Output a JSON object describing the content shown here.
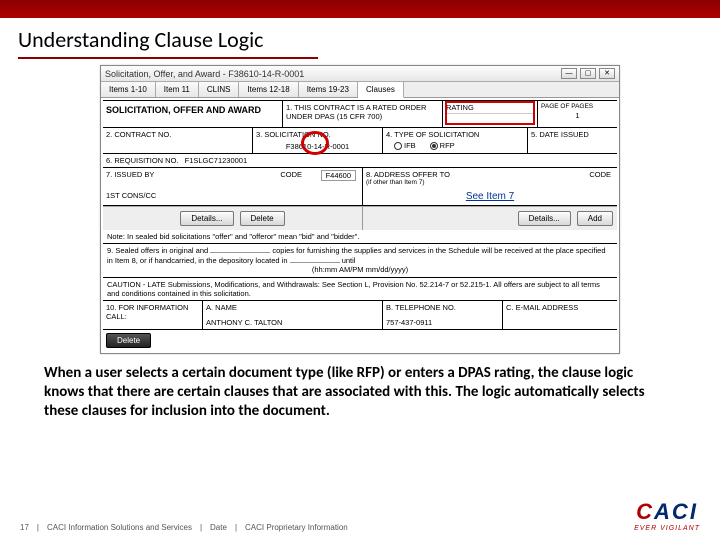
{
  "slide": {
    "title": "Understanding Clause Logic",
    "body": "When a user selects a certain document type (like RFP) or enters a DPAS rating, the clause logic knows that there are certain clauses that are associated with this.  The logic automatically selects these clauses for inclusion into the document."
  },
  "window": {
    "title": "Solicitation, Offer, and Award - F38610-14-R-0001",
    "tabs": [
      "Items 1-10",
      "Item 11",
      "CLINS",
      "Items 12-18",
      "Items 19-23",
      "Clauses"
    ],
    "active_tab": 5
  },
  "form": {
    "header": "SOLICITATION, OFFER AND AWARD",
    "box1": "1. THIS CONTRACT IS A RATED ORDER UNDER DPAS (15 CFR 700)",
    "rating_label": "RATING",
    "page_label": "PAGE   OF   PAGES",
    "page_value": "1",
    "box2": "2. CONTRACT NO.",
    "box3_label": "3. SOLICITATION NO.",
    "box3_value": "F38610-14-R-0001",
    "box4_label": "4. TYPE OF SOLICITATION",
    "box4_ifb": "IFB",
    "box4_rfp": "RFP",
    "box5": "5. DATE ISSUED",
    "box6_label": "6. REQUISITION NO.",
    "box6_value": "F1SLGC71230001",
    "box7_label": "7. ISSUED BY",
    "box7_code": "CODE",
    "box7_codeval": "F44600",
    "box7_value": "1ST CONS/CC",
    "box8_label": "8. ADDRESS OFFER TO",
    "box8_sub": "(if other than Item 7)",
    "box8_code": "CODE",
    "box8_link": "See Item 7",
    "btn_details": "Details...",
    "btn_delete": "Delete",
    "btn_details2": "Details...",
    "btn_add": "Add",
    "note": "Note: In sealed bid solicitations \"offer\" and \"offeror\" mean \"bid\" and \"bidder\".",
    "box9a": "9. Sealed offers in original and",
    "box9b": "copies for furnishing the supplies and services in the Schedule will be received at the place specified in Item 8, or if handcarried, in the depository located in",
    "box9c": "until",
    "box9d": "(hh:mm AM/PM mm/dd/yyyy)",
    "caution": "CAUTION - LATE Submissions, Modifications, and Withdrawals: See Section L, Provision No. 52.214-7 or 52.215-1. All offers are subject to all terms and conditions contained in this solicitation.",
    "box10a_label": "10. FOR INFORMATION CALL:",
    "box10a_name": "A. NAME",
    "box10a_value": "ANTHONY C. TALTON",
    "box10b_label": "B. TELEPHONE NO.",
    "box10b_value": "757-437-0911",
    "box10c_label": "C. E-MAIL ADDRESS",
    "btn_delete2": "Delete"
  },
  "footer": {
    "page": "17",
    "sep": "|",
    "org": "CACI Information Solutions and Services",
    "date_label": "Date",
    "prop": "CACI Proprietary Information"
  },
  "logo": {
    "brand": "CACI",
    "tag": "EVER VIGILANT"
  }
}
